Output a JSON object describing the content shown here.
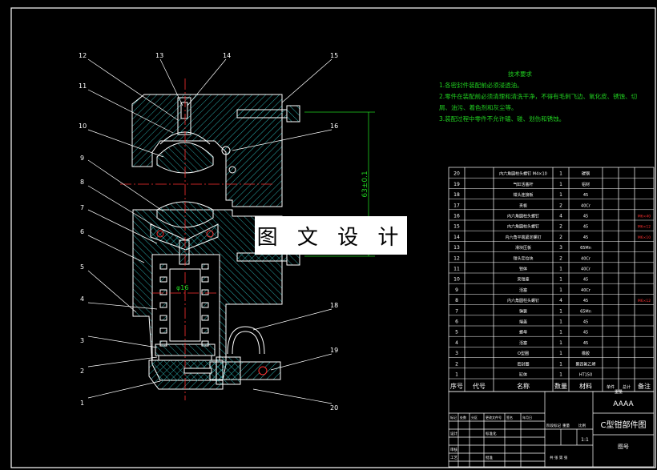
{
  "overlay_text": "图 文 设 计",
  "tech": {
    "heading": "技术要求",
    "lines": [
      "1.各密封件装配前必须浸透油。",
      "2.零件在装配前必须清理和清洗干净，不得有毛刺飞边、氧化皮、锈蚀、切屑、油污、着色剂和灰尘等。",
      "3.装配过程中零件不允许磕、碰、划伤和锈蚀。"
    ]
  },
  "callouts": [
    "1",
    "2",
    "3",
    "4",
    "5",
    "6",
    "7",
    "8",
    "9",
    "10",
    "11",
    "12",
    "13",
    "14",
    "15",
    "16",
    "17",
    "18",
    "19",
    "20"
  ],
  "dims": {
    "vertical": "63±0.1",
    "bore": "φ16"
  },
  "bom": {
    "headers": [
      "序号",
      "代号",
      "名称",
      "数量",
      "材料",
      "单件",
      "总计",
      "备注"
    ],
    "weight_header": "重量",
    "rows": [
      [
        "20",
        "",
        "内六角圆柱头螺钉 M4×10",
        "1",
        "碳钢",
        ""
      ],
      [
        "19",
        "",
        "气缸活塞杆",
        "1",
        "铝材",
        ""
      ],
      [
        "18",
        "",
        "钳头连接板",
        "1",
        "45",
        ""
      ],
      [
        "17",
        "",
        "夹板",
        "2",
        "40Cr",
        ""
      ],
      [
        "16",
        "",
        "内六角圆柱头螺钉",
        "4",
        "45",
        "M6×40"
      ],
      [
        "15",
        "",
        "内六角圆柱头螺钉",
        "2",
        "45",
        "M6×12"
      ],
      [
        "14",
        "",
        "内六角平端紧定螺钉",
        "2",
        "45",
        "M6×10"
      ],
      [
        "13",
        "",
        "滑块压板",
        "3",
        "65Mn",
        ""
      ],
      [
        "12",
        "",
        "钳头定位块",
        "2",
        "40Cr",
        ""
      ],
      [
        "11",
        "",
        "钳体",
        "1",
        "40Cr",
        ""
      ],
      [
        "10",
        "",
        "夹钳座",
        "1",
        "45",
        ""
      ],
      [
        "9",
        "",
        "活塞",
        "1",
        "40Cr",
        ""
      ],
      [
        "8",
        "",
        "内六角圆柱头螺钉",
        "4",
        "45",
        "M6×12"
      ],
      [
        "7",
        "",
        "弹簧",
        "1",
        "65Mn",
        ""
      ],
      [
        "6",
        "",
        "端盖",
        "1",
        "45",
        ""
      ],
      [
        "5",
        "",
        "螺母",
        "1",
        "45",
        ""
      ],
      [
        "4",
        "",
        "活塞",
        "1",
        "45",
        ""
      ],
      [
        "3",
        "",
        "O型圈",
        "1",
        "橡胶",
        ""
      ],
      [
        "2",
        "",
        "密封圈",
        "1",
        "聚四氟乙烯",
        ""
      ],
      [
        "1",
        "",
        "缸体",
        "1",
        "HT150",
        ""
      ]
    ]
  },
  "title_block": {
    "code": "AAAA",
    "name": "C型钳部件图",
    "drawing_no_label": "图号",
    "scale": "1:1",
    "labels": [
      "标记",
      "处数",
      "分区",
      "更改文件号",
      "签名",
      "年月日",
      "设计",
      "标准化",
      "阶段标记",
      "重量",
      "比例",
      "审核",
      "工艺",
      "批准",
      "共 张 第 张"
    ]
  }
}
